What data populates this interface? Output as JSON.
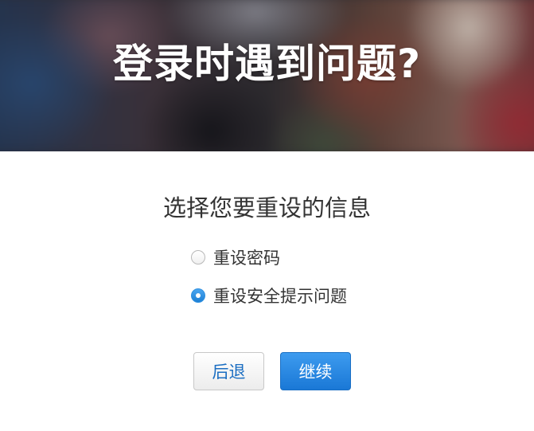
{
  "hero": {
    "title": "登录时遇到问题?"
  },
  "form": {
    "heading": "选择您要重设的信息",
    "options": [
      {
        "label": "重设密码",
        "checked": false
      },
      {
        "label": "重设安全提示问题",
        "checked": true
      }
    ]
  },
  "buttons": {
    "back_label": "后退",
    "continue_label": "继续"
  },
  "colors": {
    "accent": "#1a78d6",
    "link_text": "#1b6ec2",
    "body_text": "#333333"
  }
}
